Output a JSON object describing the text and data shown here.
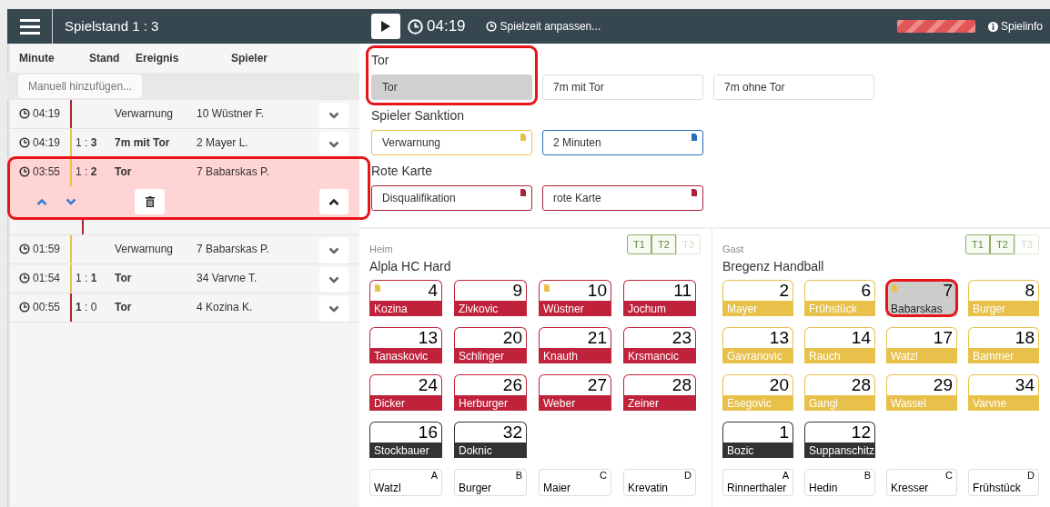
{
  "top_bar": {
    "score_title": "Spielstand 1 : 3",
    "clock": "04:19",
    "adjust_time": "Spielzeit anpassen...",
    "info": "Spielinfo"
  },
  "event_log": {
    "columns": [
      "Minute",
      "Stand",
      "Ereignis",
      "Spieler"
    ],
    "add_placeholder": "Manuell hinzufügen...",
    "rows": [
      {
        "kind": "event",
        "time": "04:19",
        "color": "#a8243a",
        "score": "",
        "event": "Verwarnung",
        "goal": false,
        "player": "10 Wüstner F.",
        "expanded": false,
        "highlighted": false
      },
      {
        "kind": "event",
        "time": "04:19",
        "color": "#e8c14a",
        "score": "1 : **3**",
        "event": "7m mit Tor",
        "goal": true,
        "player": "2 Mayer L.",
        "expanded": false,
        "highlighted": false
      },
      {
        "kind": "event",
        "time": "03:55",
        "color": "#e8c14a",
        "score": "1 : **2**",
        "event": "Tor",
        "goal": true,
        "player": "7 Babarskas P.",
        "expanded": true,
        "highlighted": true
      },
      {
        "kind": "hidden",
        "color": "#a8243a"
      },
      {
        "kind": "event",
        "time": "01:59",
        "color": "#e8c14a",
        "score": "",
        "event": "Verwarnung",
        "goal": false,
        "player": "7 Babarskas P.",
        "expanded": false,
        "highlighted": false
      },
      {
        "kind": "event",
        "time": "01:54",
        "color": "#e8c14a",
        "score": "1 : **1**",
        "event": "Tor",
        "goal": true,
        "player": "34 Varvne T.",
        "expanded": false,
        "highlighted": false
      },
      {
        "kind": "event",
        "time": "00:55",
        "color": "#a8243a",
        "score": "**1** : 0",
        "event": "Tor",
        "goal": true,
        "player": "4 Kozina K.",
        "expanded": false,
        "highlighted": false
      }
    ]
  },
  "event_groups": [
    {
      "title": "Tor",
      "buttons": [
        {
          "label": "Tor",
          "selected": true,
          "highlighted": true
        },
        {
          "label": "7m mit Tor",
          "selected": false,
          "highlighted": false
        },
        {
          "label": "7m ohne Tor",
          "selected": false,
          "highlighted": false
        }
      ]
    },
    {
      "title": "Spieler Sanktion",
      "buttons": [
        {
          "label": "Verwarnung",
          "selected": false,
          "highlighted": false,
          "color": "#e8c14a"
        },
        {
          "label": "2 Minuten",
          "selected": false,
          "highlighted": false,
          "color": "#2a6db5"
        }
      ]
    },
    {
      "title": "Rote Karte",
      "buttons": [
        {
          "label": "Disqualifikation",
          "selected": false,
          "highlighted": false,
          "color": "#a8243a"
        },
        {
          "label": "rote Karte",
          "selected": false,
          "highlighted": false,
          "color": "#a8243a"
        }
      ]
    }
  ],
  "teams": [
    {
      "side": "Heim",
      "name": "Alpla HC Hard",
      "color": "#c0223b",
      "timeouts": [
        {
          "label": "T1",
          "disabled": false
        },
        {
          "label": "T2",
          "disabled": false
        },
        {
          "label": "T3",
          "disabled": true
        }
      ],
      "players": [
        {
          "number": "4",
          "name": "Kozina",
          "kind": "court",
          "warned": true,
          "selected": false,
          "highlighted": false
        },
        {
          "number": "9",
          "name": "Zivkovic",
          "kind": "court",
          "warned": false,
          "selected": false,
          "highlighted": false
        },
        {
          "number": "10",
          "name": "Wüstner",
          "kind": "court",
          "warned": true,
          "selected": false,
          "highlighted": false
        },
        {
          "number": "11",
          "name": "Jochum",
          "kind": "court",
          "warned": false,
          "selected": false,
          "highlighted": false
        },
        {
          "number": "13",
          "name": "Tanaskovic",
          "kind": "court",
          "warned": false,
          "selected": false,
          "highlighted": false
        },
        {
          "number": "20",
          "name": "Schlinger",
          "kind": "court",
          "warned": false,
          "selected": false,
          "highlighted": false
        },
        {
          "number": "21",
          "name": "Knauth",
          "kind": "court",
          "warned": false,
          "selected": false,
          "highlighted": false
        },
        {
          "number": "23",
          "name": "Krsmancic",
          "kind": "court",
          "warned": false,
          "selected": false,
          "highlighted": false
        },
        {
          "number": "24",
          "name": "Dicker",
          "kind": "court",
          "warned": false,
          "selected": false,
          "highlighted": false
        },
        {
          "number": "26",
          "name": "Herburger",
          "kind": "court",
          "warned": false,
          "selected": false,
          "highlighted": false
        },
        {
          "number": "27",
          "name": "Weber",
          "kind": "court",
          "warned": false,
          "selected": false,
          "highlighted": false
        },
        {
          "number": "28",
          "name": "Zeiner",
          "kind": "court",
          "warned": false,
          "selected": false,
          "highlighted": false
        },
        {
          "number": "16",
          "name": "Stockbauer",
          "kind": "goalkeeper",
          "warned": false,
          "selected": false,
          "highlighted": false
        },
        {
          "number": "32",
          "name": "Doknic",
          "kind": "goalkeeper",
          "warned": false,
          "selected": false,
          "highlighted": false
        }
      ],
      "officials": [
        {
          "letter": "A",
          "name": "Watzl"
        },
        {
          "letter": "B",
          "name": "Burger"
        },
        {
          "letter": "C",
          "name": "Maier"
        },
        {
          "letter": "D",
          "name": "Krevatin"
        }
      ]
    },
    {
      "side": "Gast",
      "name": "Bregenz Handball",
      "color": "#e8c14a",
      "timeouts": [
        {
          "label": "T1",
          "disabled": false
        },
        {
          "label": "T2",
          "disabled": false
        },
        {
          "label": "T3",
          "disabled": true
        }
      ],
      "players": [
        {
          "number": "2",
          "name": "Mayer",
          "kind": "court",
          "warned": false,
          "selected": false,
          "highlighted": false
        },
        {
          "number": "6",
          "name": "Frühstück",
          "kind": "court",
          "warned": false,
          "selected": false,
          "highlighted": false
        },
        {
          "number": "7",
          "name": "Babarskas",
          "kind": "court",
          "warned": true,
          "selected": true,
          "highlighted": true
        },
        {
          "number": "8",
          "name": "Burger",
          "kind": "court",
          "warned": false,
          "selected": false,
          "highlighted": false
        },
        {
          "number": "13",
          "name": "Gavranovic",
          "kind": "court",
          "warned": false,
          "selected": false,
          "highlighted": false
        },
        {
          "number": "14",
          "name": "Rauch",
          "kind": "court",
          "warned": false,
          "selected": false,
          "highlighted": false
        },
        {
          "number": "17",
          "name": "Watzl",
          "kind": "court",
          "warned": false,
          "selected": false,
          "highlighted": false
        },
        {
          "number": "18",
          "name": "Bammer",
          "kind": "court",
          "warned": false,
          "selected": false,
          "highlighted": false
        },
        {
          "number": "20",
          "name": "Esegovic",
          "kind": "court",
          "warned": false,
          "selected": false,
          "highlighted": false
        },
        {
          "number": "28",
          "name": "Gangl",
          "kind": "court",
          "warned": false,
          "selected": false,
          "highlighted": false
        },
        {
          "number": "29",
          "name": "Wassel",
          "kind": "court",
          "warned": false,
          "selected": false,
          "highlighted": false
        },
        {
          "number": "34",
          "name": "Varvne",
          "kind": "court",
          "warned": false,
          "selected": false,
          "highlighted": false
        },
        {
          "number": "1",
          "name": "Bozic",
          "kind": "goalkeeper",
          "warned": false,
          "selected": false,
          "highlighted": false
        },
        {
          "number": "12",
          "name": "Suppanschitz",
          "kind": "goalkeeper",
          "warned": false,
          "selected": false,
          "highlighted": false
        }
      ],
      "officials": [
        {
          "letter": "A",
          "name": "Rinnerthaler"
        },
        {
          "letter": "B",
          "name": "Hedin"
        },
        {
          "letter": "C",
          "name": "Kresser"
        },
        {
          "letter": "D",
          "name": "Frühstück"
        }
      ]
    }
  ]
}
